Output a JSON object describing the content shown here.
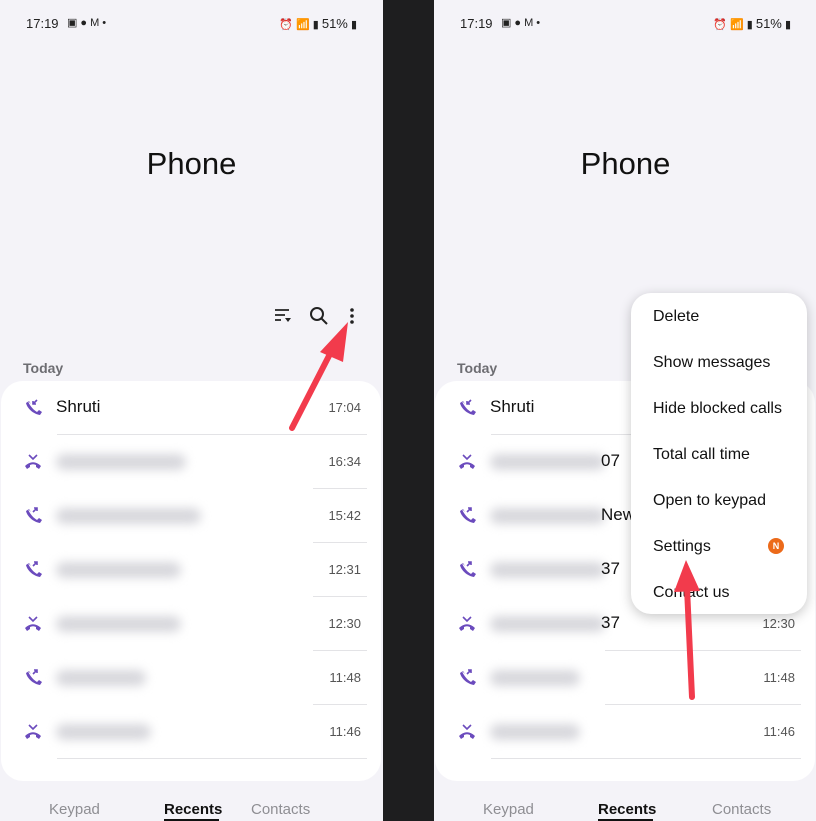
{
  "status_bar": {
    "time": "17:19",
    "notification_icons": [
      "image-icon",
      "facebook-icon",
      "gmail-icon",
      "more-dot-icon"
    ],
    "battery": "51%"
  },
  "app": {
    "title": "Phone"
  },
  "section": {
    "today": "Today"
  },
  "calls": [
    {
      "name": "Shruti",
      "time": "17:04",
      "type": "incoming"
    },
    {
      "name": "",
      "time": "16:34",
      "type": "missed"
    },
    {
      "name": "",
      "time": "15:42",
      "type": "outgoing"
    },
    {
      "name": "",
      "time": "12:31",
      "type": "outgoing"
    },
    {
      "name": "",
      "time": "12:30",
      "type": "missed"
    },
    {
      "name": "",
      "time": "11:48",
      "type": "outgoing"
    },
    {
      "name": "",
      "time": "11:46",
      "type": "missed"
    }
  ],
  "right_calls": [
    {
      "name": "Shruti",
      "suffix": "",
      "time": ""
    },
    {
      "name": "",
      "suffix": "07",
      "time": ""
    },
    {
      "name": "",
      "suffix": "New",
      "time": ""
    },
    {
      "name": "",
      "suffix": "37",
      "time": ""
    },
    {
      "name": "",
      "suffix": "37",
      "time": "12:30"
    },
    {
      "name": "",
      "suffix": "",
      "time": "11:48"
    },
    {
      "name": "",
      "suffix": "",
      "time": "11:46"
    }
  ],
  "menu": {
    "items": [
      "Delete",
      "Show messages",
      "Hide blocked calls",
      "Total call time",
      "Open to keypad",
      "Settings",
      "Contact us"
    ],
    "settings_badge": "N"
  },
  "nav": {
    "keypad": "Keypad",
    "recents": "Recents",
    "contacts": "Contacts"
  },
  "colors": {
    "accent": "#6b4bbd",
    "arrow": "#f23b4c",
    "badge": "#ec6a1a"
  }
}
